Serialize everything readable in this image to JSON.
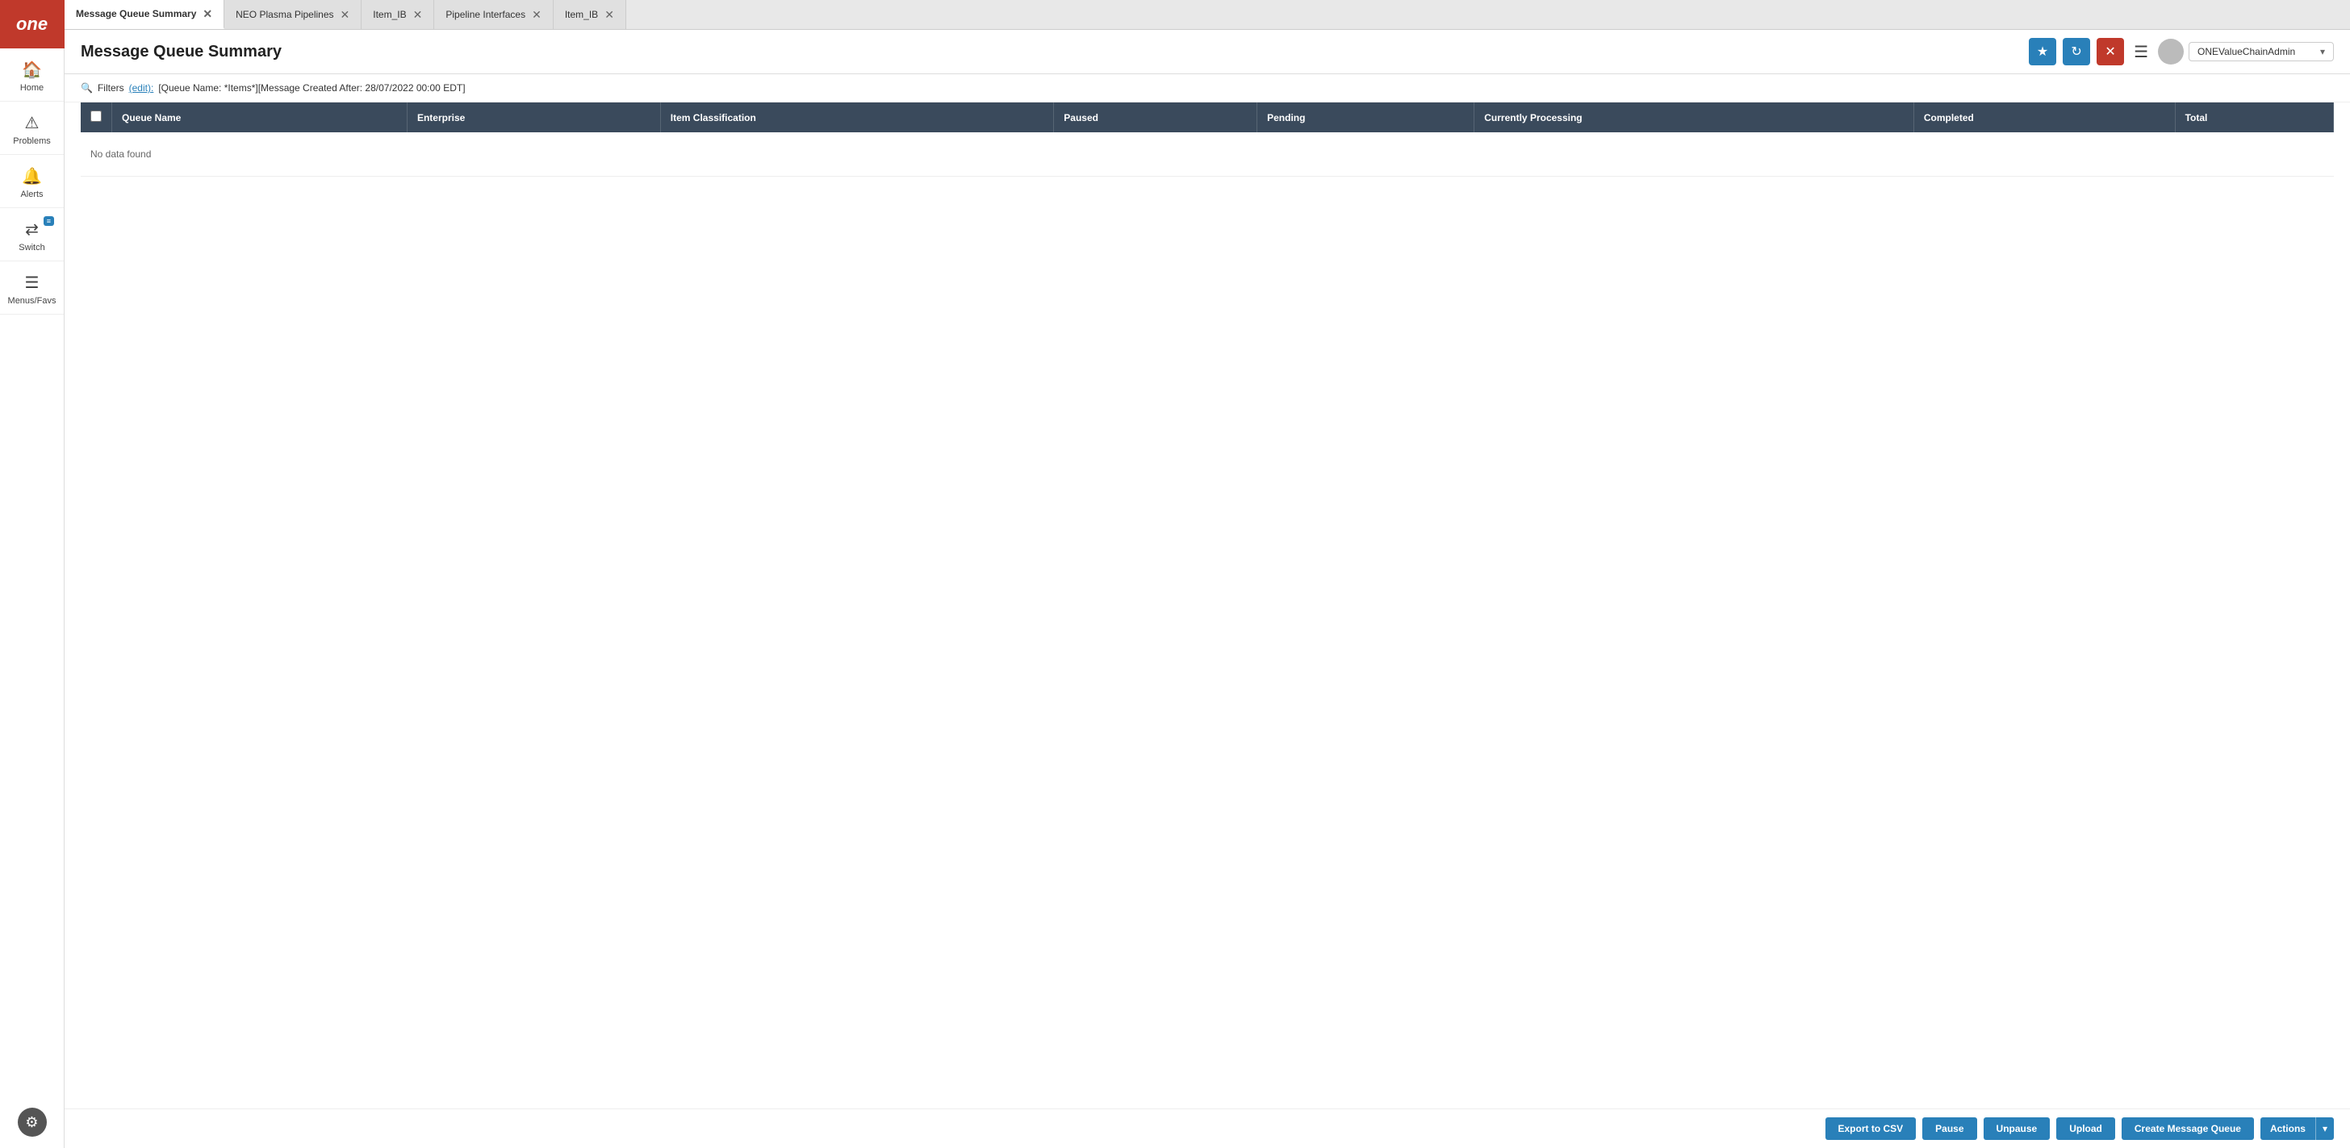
{
  "logo": {
    "text": "one"
  },
  "sidebar": {
    "items": [
      {
        "id": "home",
        "icon": "🏠",
        "label": "Home"
      },
      {
        "id": "problems",
        "icon": "⚠",
        "label": "Problems"
      },
      {
        "id": "alerts",
        "icon": "🔔",
        "label": "Alerts"
      },
      {
        "id": "switch",
        "icon": "⇄",
        "label": "Switch",
        "badge": "≡"
      }
    ],
    "bottom_items": [
      {
        "id": "menus-favs",
        "icon": "☰",
        "label": "Menus/Favs"
      }
    ],
    "settings_icon": "⚙"
  },
  "tabs": [
    {
      "id": "tab-message-queue",
      "label": "Message Queue Summary",
      "active": true
    },
    {
      "id": "tab-neo-plasma",
      "label": "NEO Plasma Pipelines",
      "active": false
    },
    {
      "id": "tab-item-ib-1",
      "label": "Item_IB",
      "active": false
    },
    {
      "id": "tab-pipeline-interfaces",
      "label": "Pipeline Interfaces",
      "active": false
    },
    {
      "id": "tab-item-ib-2",
      "label": "Item_IB",
      "active": false
    }
  ],
  "header": {
    "title": "Message Queue Summary",
    "buttons": {
      "star_label": "★",
      "refresh_label": "↻",
      "close_label": "✕",
      "menu_label": "☰"
    },
    "user": {
      "name": "ONEValueChainAdmin",
      "avatar_bg": "#bbb"
    }
  },
  "filter_bar": {
    "icon": "🔍",
    "filters_label": "Filters",
    "edit_label": "(edit):",
    "filter_text": "[Queue Name: *Items*][Message Created After: 28/07/2022 00:00 EDT]"
  },
  "table": {
    "columns": [
      {
        "id": "checkbox",
        "label": ""
      },
      {
        "id": "queue-name",
        "label": "Queue Name"
      },
      {
        "id": "enterprise",
        "label": "Enterprise"
      },
      {
        "id": "item-classification",
        "label": "Item Classification"
      },
      {
        "id": "paused",
        "label": "Paused"
      },
      {
        "id": "pending",
        "label": "Pending"
      },
      {
        "id": "currently-processing",
        "label": "Currently Processing"
      },
      {
        "id": "completed",
        "label": "Completed"
      },
      {
        "id": "total",
        "label": "Total"
      }
    ],
    "no_data_text": "No data found",
    "rows": []
  },
  "bottom_bar": {
    "buttons": [
      {
        "id": "export-csv",
        "label": "Export to CSV"
      },
      {
        "id": "pause",
        "label": "Pause"
      },
      {
        "id": "unpause",
        "label": "Unpause"
      },
      {
        "id": "upload",
        "label": "Upload"
      },
      {
        "id": "create-message-queue",
        "label": "Create Message Queue"
      },
      {
        "id": "actions",
        "label": "Actions",
        "has_arrow": true
      }
    ]
  }
}
